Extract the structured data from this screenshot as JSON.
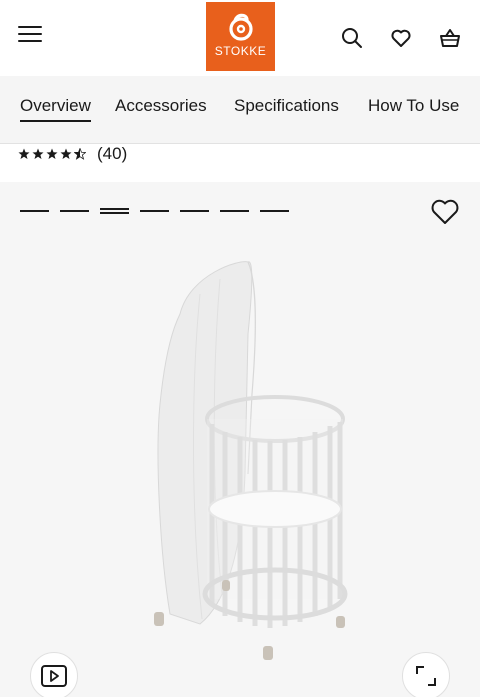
{
  "header": {
    "brand": "STOKKE",
    "brand_color": "#e8601c",
    "icons": [
      "menu-icon",
      "search-icon",
      "heart-icon",
      "basket-icon"
    ]
  },
  "subnav": {
    "tabs": [
      {
        "label": "Overview",
        "active": true
      },
      {
        "label": "Accessories",
        "active": false
      },
      {
        "label": "Specifications",
        "active": false
      },
      {
        "label": "How To Use",
        "active": false
      }
    ]
  },
  "rating": {
    "stars": 4.5,
    "count": "(40)"
  },
  "gallery": {
    "image_count": 7,
    "active_index": 2,
    "image": "white oval crib with canopy",
    "buttons": [
      "play-video-icon",
      "expand-icon",
      "heart-icon"
    ]
  }
}
